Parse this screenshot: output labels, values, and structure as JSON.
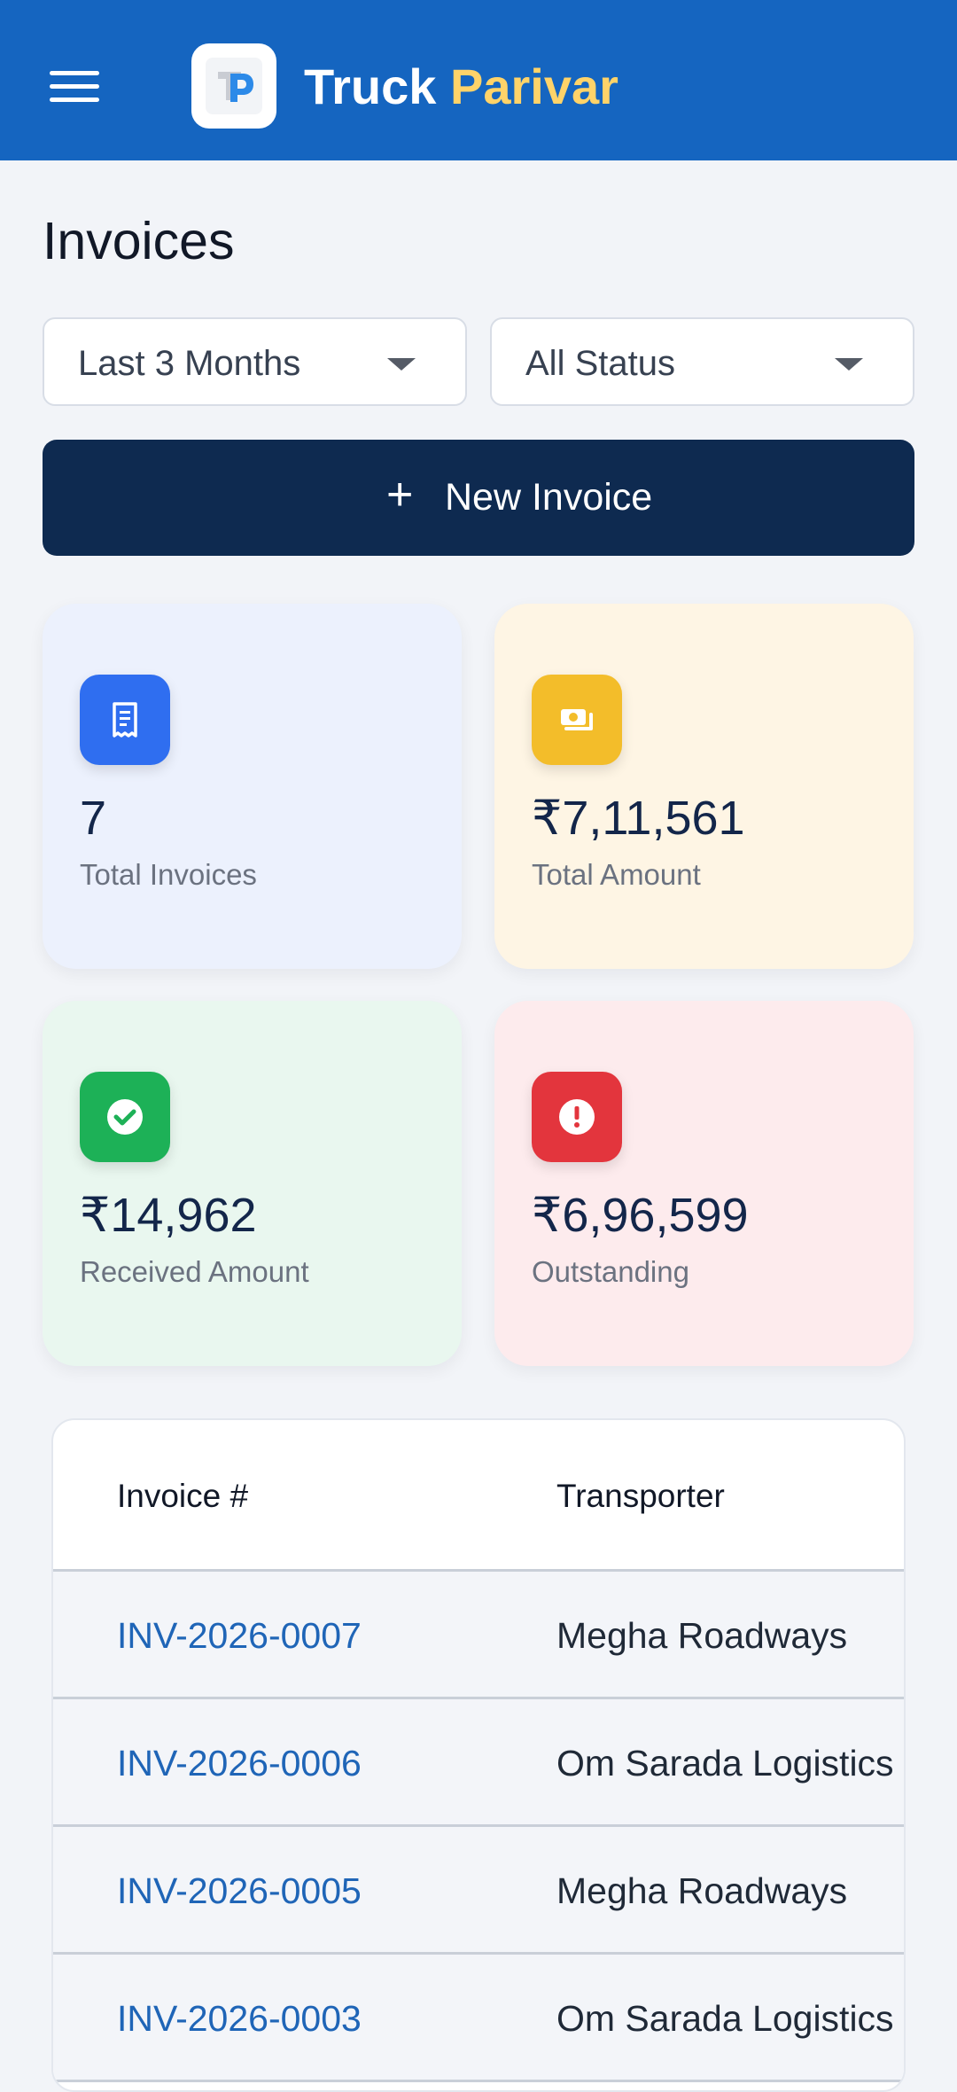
{
  "header": {
    "brand_part1": "Truck",
    "brand_part2": "Parivar",
    "brand_colors": {
      "primary": "#ffffff",
      "accent": "#ffd369",
      "bar": "#1565c0"
    },
    "menu_icon": "hamburger-menu-icon",
    "logo_icon": "truck-parivar-logo"
  },
  "page": {
    "title": "Invoices"
  },
  "filters": {
    "period": "Last 3 Months",
    "status": "All Status"
  },
  "actions": {
    "new_invoice_plus": "+",
    "new_invoice_label": "New Invoice"
  },
  "stats": [
    {
      "value": "7",
      "label": "Total Invoices",
      "icon": "receipt-icon",
      "color": "#2f6ef0"
    },
    {
      "value": "₹7,11,561",
      "label": "Total Amount",
      "icon": "cash-icon",
      "color": "#f3bd2a"
    },
    {
      "value": "₹14,962",
      "label": "Received Amount",
      "icon": "check-circle-icon",
      "color": "#1db157"
    },
    {
      "value": "₹6,96,599",
      "label": "Outstanding",
      "icon": "alert-circle-icon",
      "color": "#e3353d"
    }
  ],
  "table": {
    "columns": [
      "Invoice #",
      "Transporter"
    ],
    "rows": [
      {
        "invoice": "INV-2026-0007",
        "transporter": "Megha Roadways"
      },
      {
        "invoice": "INV-2026-0006",
        "transporter": "Om Sarada Logistics"
      },
      {
        "invoice": "INV-2026-0005",
        "transporter": "Megha Roadways"
      },
      {
        "invoice": "INV-2026-0003",
        "transporter": "Om Sarada Logistics"
      }
    ]
  }
}
